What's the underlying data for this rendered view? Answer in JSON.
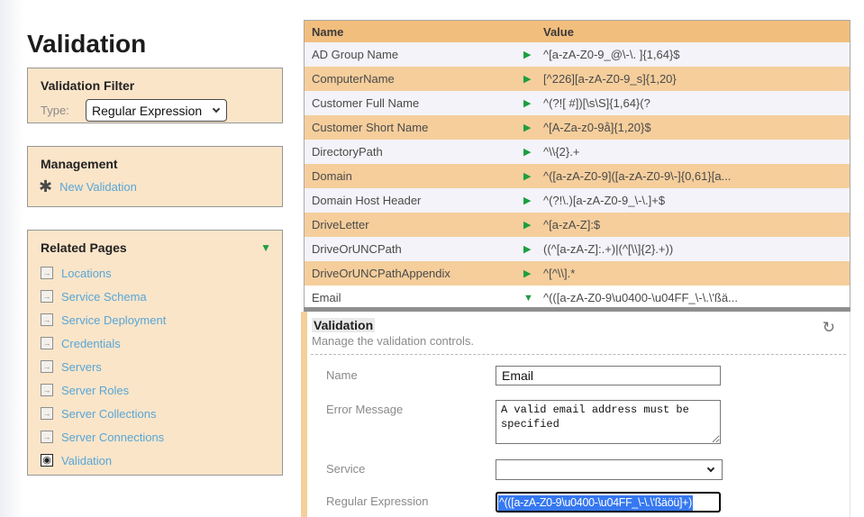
{
  "page": {
    "title": "Validation"
  },
  "colors": {
    "accent_orange_header": "#f2be7e",
    "accent_orange_row": "#f5ce9c",
    "sidebar_box_bg": "#fae5c9",
    "row_light": "#f3f3f9",
    "link_blue": "#58a6d6",
    "arrow_green": "#1d9e3f",
    "selection_blue": "#3678f0"
  },
  "sidebar": {
    "filter": {
      "title": "Validation Filter",
      "type_label": "Type:",
      "type_value": "Regular Expression"
    },
    "management": {
      "title": "Management",
      "new_link": "New Validation"
    },
    "related": {
      "title": "Related Pages",
      "toggle_icon": "▼",
      "items": [
        {
          "label": "Locations",
          "icon": "arrow"
        },
        {
          "label": "Service Schema",
          "icon": "arrow"
        },
        {
          "label": "Service Deployment",
          "icon": "arrow"
        },
        {
          "label": "Credentials",
          "icon": "arrow"
        },
        {
          "label": "Servers",
          "icon": "arrow"
        },
        {
          "label": "Server Roles",
          "icon": "arrow"
        },
        {
          "label": "Server Collections",
          "icon": "arrow"
        },
        {
          "label": "Server Connections",
          "icon": "arrow"
        },
        {
          "label": "Validation",
          "icon": "target"
        }
      ]
    }
  },
  "table": {
    "columns": [
      "Name",
      "Value"
    ],
    "rows": [
      {
        "name": "AD Group Name",
        "value": "^[a-zA-Z0-9_@\\-\\. ]{1,64}$",
        "expanded": false
      },
      {
        "name": "ComputerName",
        "value": "[^226][a-zA-Z0-9_s]{1,20}",
        "expanded": false
      },
      {
        "name": "Customer Full Name",
        "value": "^(?![ #])[\\s\\S]{1,64}(?",
        "expanded": false
      },
      {
        "name": "Customer Short Name",
        "value": "^[A-Za-z0-9å]{1,20}$",
        "expanded": false
      },
      {
        "name": "DirectoryPath",
        "value": "^\\\\{2}.+",
        "expanded": false
      },
      {
        "name": "Domain",
        "value": "^([a-zA-Z0-9]([a-zA-Z0-9\\-]{0,61}[a...",
        "expanded": false
      },
      {
        "name": "Domain Host Header",
        "value": "^(?!\\.)[a-zA-Z0-9_\\-\\.]+$",
        "expanded": false
      },
      {
        "name": "DriveLetter",
        "value": "^[a-zA-Z]:$",
        "expanded": false
      },
      {
        "name": "DriveOrUNCPath",
        "value": "((^[a-zA-Z]:.+)|(^[\\\\]{2}.+))",
        "expanded": false
      },
      {
        "name": "DriveOrUNCPathAppendix",
        "value": "^[^\\\\].*",
        "expanded": false
      },
      {
        "name": "Email",
        "value": "^(([a-zA-Z0-9\\u0400-\\u04FF_\\-\\.\\'ßä...",
        "expanded": true
      }
    ]
  },
  "detail": {
    "title": "Validation",
    "subtitle": "Manage the validation controls.",
    "fields": {
      "name_label": "Name",
      "name_value": "Email",
      "error_label": "Error Message",
      "error_value": "A valid email address must be specified",
      "service_label": "Service",
      "service_value": "",
      "regex_label": "Regular Expression",
      "regex_value": "^(([a-zA-Z0-9\\u0400-\\u04FF_\\-\\.\\'ßäöü]+)"
    }
  }
}
